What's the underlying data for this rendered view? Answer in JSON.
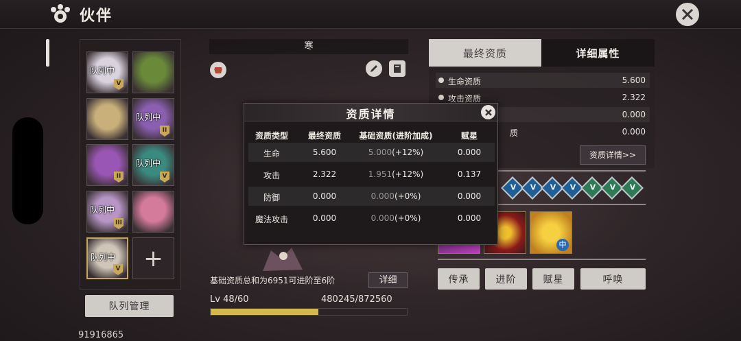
{
  "header": {
    "title": "伙伴"
  },
  "roster": {
    "slots": [
      {
        "tag": "队列中",
        "rank": "V",
        "color": "#d9d3de"
      },
      {
        "tag": "",
        "rank": "",
        "color": "#6a8a3a"
      },
      {
        "tag": "",
        "rank": "",
        "color": "#c9b07a"
      },
      {
        "tag": "队列中",
        "rank": "II",
        "color": "#8a5fb0"
      },
      {
        "tag": "",
        "rank": "II",
        "color": "#9a56b4"
      },
      {
        "tag": "队列中",
        "rank": "V",
        "color": "#3b8a80"
      },
      {
        "tag": "队列中",
        "rank": "III",
        "color": "#b796c6"
      },
      {
        "tag": "",
        "rank": "",
        "color": "#d47a9a"
      },
      {
        "tag": "队列中",
        "rank": "V",
        "color": "#cfc5b8"
      },
      {
        "tag": "",
        "rank": "",
        "color": ""
      }
    ],
    "team_button": "队列管理",
    "id_text": "91916865"
  },
  "center": {
    "name": "寒",
    "base_text": "基础资质总和为6951可进阶至6阶",
    "detail_button": "详细",
    "level": "Lv 48/60",
    "exp": "480245/872560",
    "exp_fraction": 0.55
  },
  "right_panel": {
    "tabs": [
      "最终资质",
      "详细属性"
    ],
    "attributes": [
      {
        "name": "生命资质",
        "value": "5.600"
      },
      {
        "name": "攻击资质",
        "value": "2.322"
      },
      {
        "name": "",
        "value": "0.000"
      },
      {
        "name": "质",
        "value": "0.000"
      }
    ],
    "aptitude_button": "资质详情>>",
    "stars": [
      {
        "type": "blue",
        "label": "V"
      },
      {
        "type": "blue",
        "label": "V"
      },
      {
        "type": "blue",
        "label": "V"
      },
      {
        "type": "blue",
        "label": "V"
      },
      {
        "type": "green",
        "label": "V"
      },
      {
        "type": "green",
        "label": "V"
      },
      {
        "type": "green",
        "label": "V"
      }
    ],
    "skill_badge": "中",
    "buttons": [
      "传承",
      "进阶",
      "赋星",
      "呼唤"
    ]
  },
  "modal": {
    "title": "资质详情",
    "headers": [
      "资质类型",
      "最终资质",
      "基础资质(进阶加成)",
      "赋星"
    ],
    "rows": [
      {
        "type": "生命",
        "final": "5.600",
        "base": "5.000",
        "bonus": "(+12%)",
        "star": "0.000"
      },
      {
        "type": "攻击",
        "final": "2.322",
        "base": "1.951",
        "bonus": "(+12%)",
        "star": "0.137"
      },
      {
        "type": "防御",
        "final": "0.000",
        "base": "0.000",
        "bonus": "(+0%)",
        "star": "0.000"
      },
      {
        "type": "魔法攻击",
        "final": "0.000",
        "base": "0.000",
        "bonus": "(+0%)",
        "star": "0.000"
      }
    ]
  }
}
